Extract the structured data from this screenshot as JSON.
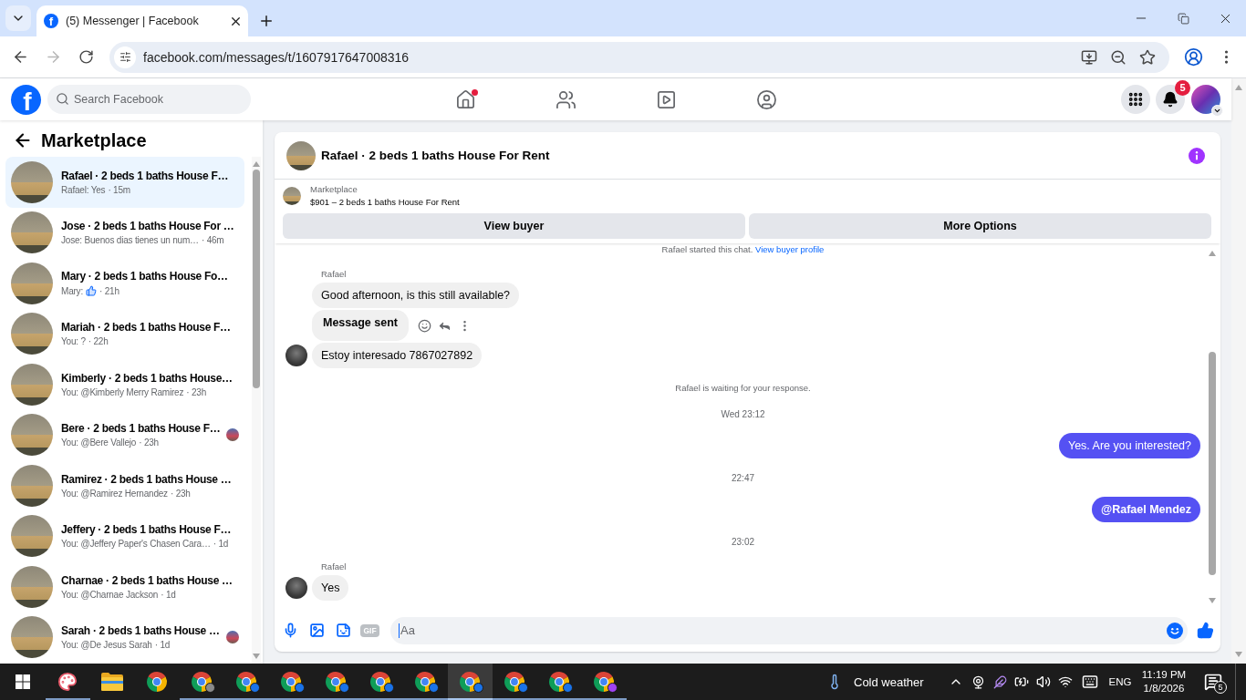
{
  "browser": {
    "tabs": [
      {
        "favicon": "f",
        "title": "(5) Messenger | Facebook",
        "selected": true
      }
    ],
    "url": "facebook.com/messages/t/1607917647008316",
    "forward_disabled": true
  },
  "topbar": {
    "logo": "f",
    "search_placeholder": "Search Facebook",
    "nav": [
      {
        "kind": "home",
        "selected": false,
        "dot": true
      },
      {
        "kind": "friends",
        "selected": false,
        "dot": false
      },
      {
        "kind": "video",
        "selected": false,
        "dot": false
      },
      {
        "kind": "groups",
        "selected": false,
        "dot": false
      }
    ],
    "notification_count": "5"
  },
  "sidebar": {
    "title": "Marketplace",
    "chats": [
      {
        "title": "Rafael · 2 beds 1 baths House F…",
        "preview": "Rafael: Yes",
        "like_icon": false,
        "time": "· 15m",
        "selected": true,
        "seen": false
      },
      {
        "title": "Jose · 2 beds 1 baths House For …",
        "preview": "Jose: Buenos dias tienes un num…",
        "like_icon": false,
        "time": "· 46m",
        "selected": false,
        "seen": false
      },
      {
        "title": "Mary · 2 beds 1 baths House Fo…",
        "preview": "Mary:",
        "like_icon": true,
        "time": "· 21h",
        "selected": false,
        "seen": false
      },
      {
        "title": "Mariah · 2 beds 1 baths House F…",
        "preview": "You: ?",
        "like_icon": false,
        "time": "· 22h",
        "selected": false,
        "seen": false
      },
      {
        "title": "Kimberly · 2 beds 1 baths House…",
        "preview": "You: @Kimberly Merry Ramirez",
        "like_icon": false,
        "time": "· 23h",
        "selected": false,
        "seen": false
      },
      {
        "title": "Bere · 2 beds 1 baths House F…",
        "preview": "You: @Bere Vallejo",
        "like_icon": false,
        "time": "· 23h",
        "selected": false,
        "seen": true
      },
      {
        "title": "Ramirez · 2 beds 1 baths House …",
        "preview": "You: @Ramirez Hernandez",
        "like_icon": false,
        "time": "· 23h",
        "selected": false,
        "seen": false
      },
      {
        "title": "Jeffery · 2 beds 1 baths House F…",
        "preview": "You: @Jeffery Paper's Chasen Cara…",
        "like_icon": false,
        "time": "· 1d",
        "selected": false,
        "seen": false
      },
      {
        "title": "Charnae · 2 beds 1 baths House …",
        "preview": "You: @Charnae Jackson",
        "like_icon": false,
        "time": "· 1d",
        "selected": false,
        "seen": false
      },
      {
        "title": "Sarah · 2 beds 1 baths House …",
        "preview": "You: @De Jesus Sarah",
        "like_icon": false,
        "time": "· 1d",
        "selected": false,
        "seen": true
      }
    ]
  },
  "chat": {
    "title": "Rafael · 2 beds 1 baths House For Rent",
    "listing_source": "Marketplace",
    "listing_title": "$901 – 2 beds 1 baths House For Rent",
    "buttons": [
      "View buyer",
      "More Options"
    ],
    "intro": "Rafael started this chat.",
    "intro_link": "View buyer profile",
    "messages": [
      {
        "kind": "sender",
        "text": "Rafael"
      },
      {
        "kind": "incoming",
        "text": "Good afternoon, is this still available?",
        "bold": false,
        "avatar": false,
        "hovered": false
      },
      {
        "kind": "incoming",
        "text": "Message sent",
        "bold": true,
        "avatar": false,
        "hovered": true
      },
      {
        "kind": "incoming",
        "text": "Estoy interesado 7867027892",
        "bold": false,
        "avatar": true,
        "hovered": false
      },
      {
        "kind": "notice",
        "text": "Rafael is waiting for your response."
      },
      {
        "kind": "time",
        "text": "Wed 23:12"
      },
      {
        "kind": "outgoing",
        "text": "Yes. Are you interested?",
        "bold": false
      },
      {
        "kind": "time",
        "text": "22:47"
      },
      {
        "kind": "outgoing",
        "text": "@Rafael Mendez",
        "bold": true
      },
      {
        "kind": "time",
        "text": "23:02"
      },
      {
        "kind": "sender",
        "text": "Rafael"
      },
      {
        "kind": "incoming",
        "text": "Yes",
        "bold": false,
        "avatar": true,
        "hovered": false
      }
    ],
    "composer": {
      "gif": "GIF",
      "placeholder": "Aa",
      "focused": true
    }
  },
  "taskbar": {
    "apps": [
      {
        "kind": "paint",
        "running": true,
        "selected": false
      },
      {
        "kind": "folder",
        "running": false,
        "selected": false
      },
      {
        "kind": "browser",
        "running": false,
        "selected": false
      },
      {
        "kind": "browser",
        "running": true,
        "selected": false,
        "color": "#8a8a8a"
      },
      {
        "kind": "browser",
        "running": true,
        "selected": false,
        "color": "#1a73e8"
      },
      {
        "kind": "browser",
        "running": true,
        "selected": false,
        "color": "#1a73e8"
      },
      {
        "kind": "browser",
        "running": true,
        "selected": false,
        "color": "#1a73e8"
      },
      {
        "kind": "browser",
        "running": true,
        "selected": false,
        "color": "#1a73e8"
      },
      {
        "kind": "browser",
        "running": true,
        "selected": false,
        "color": "#1a73e8"
      },
      {
        "kind": "browser",
        "running": true,
        "selected": true,
        "color": "#1a73e8"
      },
      {
        "kind": "browser",
        "running": true,
        "selected": false,
        "color": "#1a73e8"
      },
      {
        "kind": "browser",
        "running": true,
        "selected": false,
        "color": "#1a73e8"
      },
      {
        "kind": "browser",
        "running": true,
        "selected": false,
        "color": "#a142f4"
      }
    ],
    "weather": "Cold weather",
    "language": "ENG",
    "time": "11:19 PM",
    "date": "1/8/2026",
    "notification_count": "5"
  }
}
